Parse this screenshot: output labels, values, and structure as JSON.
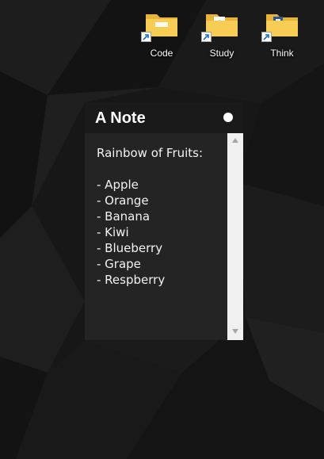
{
  "desktop": {
    "icons": [
      {
        "label": "Code",
        "icon": "folder-shortcut-icon"
      },
      {
        "label": "Study",
        "icon": "folder-shortcut-icon"
      },
      {
        "label": "Think",
        "icon": "folder-shortcut-icon"
      }
    ]
  },
  "note": {
    "title": "A Note",
    "content": "Rainbow of Fruits:\n\n- Apple\n- Orange\n- Banana\n- Kiwi\n- Blueberry\n- Grape\n- Respberry",
    "accent": "#ffffff",
    "background": "#242424",
    "header_background": "#1a1a1a"
  }
}
